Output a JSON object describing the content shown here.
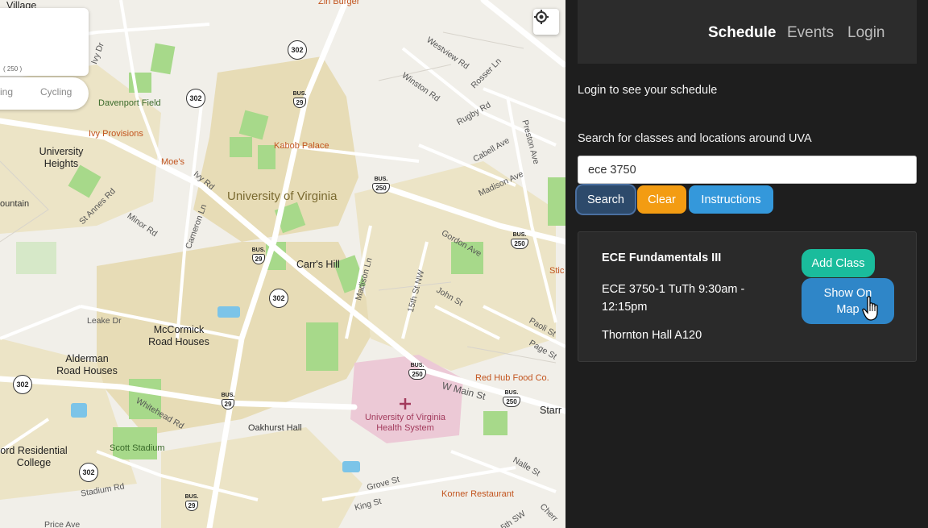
{
  "map": {
    "labels": {
      "village": "Village",
      "zin_burger": "Zin Burger",
      "davenport_field": "Davenport Field",
      "ivy_provisions": "Ivy Provisions",
      "kabob_palace": "Kabob Palace",
      "university_heights": "University Heights",
      "moes": "Moe's",
      "university_of_virginia": "University of Virginia",
      "carrs_hill": "Carr's Hill",
      "mccormick_road_houses": "McCormick Road Houses",
      "alderman_road_houses": "Alderman Road Houses",
      "red_hub_food_co": "Red Hub Food Co.",
      "uva_health_system": "University of Virginia Health System",
      "oakhurst_hall": "Oakhurst Hall",
      "scott_stadium": "Scott Stadium",
      "residential_college": "ord Residential College",
      "korner_restaurant": "Korner Restaurant",
      "ountain": "ountain",
      "stic": "Stic",
      "starr": "Starr"
    },
    "streets": {
      "ivy_dr": "Ivy Dr",
      "westview_rd": "Westview Rd",
      "winston_rd": "Winston Rd",
      "rosser_ln": "Rosser Ln",
      "rugby_rd": "Rugby Rd",
      "preston_ave": "Preston Ave",
      "cabell_ave": "Cabell Ave",
      "madison_ave": "Madison Ave",
      "ivy_rd": "Ivy Rd",
      "st_annes_rd": "St Annes Rd",
      "minor_rd": "Minor Rd",
      "cameron_ln": "Cameron Ln",
      "gordon_ave": "Gordon Ave",
      "madison_ln": "Madison Ln",
      "15th_st_nw": "15th St NW",
      "john_st": "John St",
      "paoli_st": "Paoli St",
      "page_st": "Page St",
      "leake_dr": "Leake Dr",
      "w_main_st": "W Main St",
      "whitehead_rd": "Whitehead Rd",
      "stadium_rd": "Stadium Rd",
      "grove_st": "Grove St",
      "king_st": "King St",
      "nalle_st": "Nalle St",
      "price_ave": "Price Ave",
      "cherry": "Cherr",
      "5th_sw": "5th SW"
    },
    "shields": {
      "r302": "302",
      "r29": "29",
      "r250": "250",
      "bus": "BUS."
    },
    "directions_card": {
      "scale": "( 250 )"
    },
    "mode_tabs": {
      "left": "ing",
      "cycling": "Cycling"
    },
    "locate_icon": "crosshair-icon"
  },
  "navbar": {
    "schedule": "Schedule",
    "events": "Events",
    "login": "Login"
  },
  "panel": {
    "login_message": "Login to see your schedule",
    "search_label": "Search for classes and locations around UVA",
    "search_value": "ece 3750",
    "buttons": {
      "search": "Search",
      "clear": "Clear",
      "instructions": "Instructions"
    }
  },
  "result": {
    "title": "ECE Fundamentals III",
    "section": "ECE 3750-1 TuTh 9:30am - 12:15pm",
    "location": "Thornton Hall A120",
    "add_class": "Add Class",
    "show_on_map": "Show On Map"
  },
  "colors": {
    "search_btn": "#2d4a6b",
    "clear_btn": "#f39c12",
    "instructions_btn": "#3498db",
    "add_class_btn": "#1abc9c",
    "show_map_btn": "#2f86c8",
    "panel_bg": "#1e1e1e"
  }
}
